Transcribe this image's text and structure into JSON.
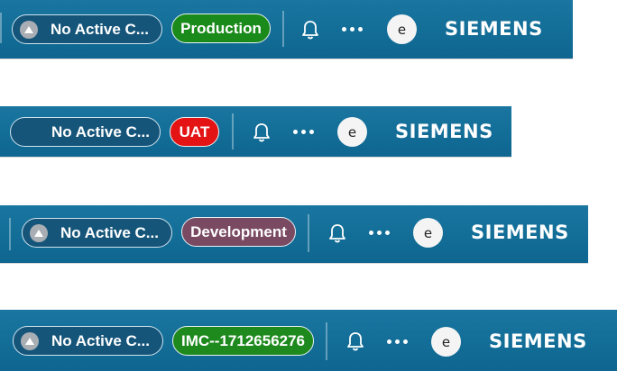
{
  "colors": {
    "bar_background": "#126d97",
    "production": "#1a8a1a",
    "uat": "#e41414",
    "development": "#7a4a62",
    "imc": "#1e8a1e"
  },
  "bars": [
    {
      "context_label": "No Active C...",
      "context_icon": "context-app-icon",
      "env_label": "Production",
      "avatar_initial": "e",
      "logo": "SIEMENS"
    },
    {
      "context_label": "No Active C...",
      "context_icon": "",
      "env_label": "UAT",
      "avatar_initial": "e",
      "logo": "SIEMENS"
    },
    {
      "context_label": "No Active C...",
      "context_icon": "context-app-icon",
      "env_label": "Development",
      "avatar_initial": "e",
      "logo": "SIEMENS"
    },
    {
      "context_label": "No Active C...",
      "context_icon": "context-app-icon",
      "env_label": "IMC--1712656276",
      "avatar_initial": "e",
      "logo": "SIEMENS"
    }
  ]
}
